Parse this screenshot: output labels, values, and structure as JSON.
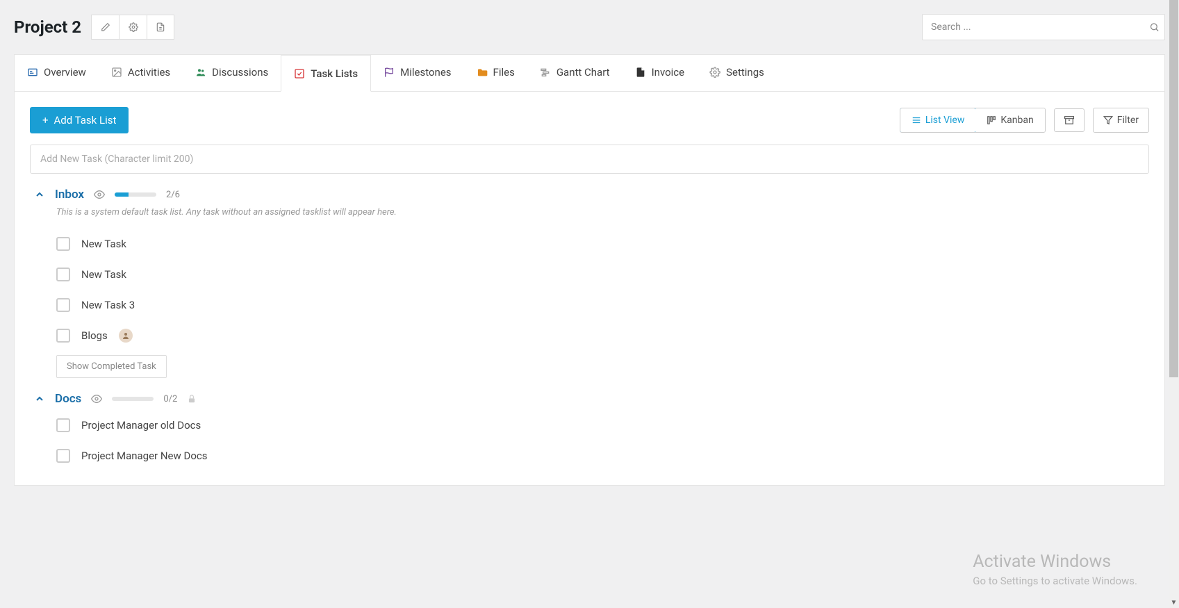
{
  "header": {
    "title": "Project 2",
    "search_placeholder": "Search ..."
  },
  "tabs": [
    {
      "id": "overview",
      "label": "Overview",
      "icon": "overview",
      "color": "#2b6cb0"
    },
    {
      "id": "activities",
      "label": "Activities",
      "icon": "image",
      "color": "#999"
    },
    {
      "id": "discussions",
      "label": "Discussions",
      "icon": "people",
      "color": "#2e8b57"
    },
    {
      "id": "tasklists",
      "label": "Task Lists",
      "icon": "check",
      "color": "#d63638",
      "active": true
    },
    {
      "id": "milestones",
      "label": "Milestones",
      "icon": "flag",
      "color": "#7a4fa0"
    },
    {
      "id": "files",
      "label": "Files",
      "icon": "folder",
      "color": "#e28c1f"
    },
    {
      "id": "gantt",
      "label": "Gantt Chart",
      "icon": "gantt",
      "color": "#999"
    },
    {
      "id": "invoice",
      "label": "Invoice",
      "icon": "doc",
      "color": "#333"
    },
    {
      "id": "settings",
      "label": "Settings",
      "icon": "gear",
      "color": "#999"
    }
  ],
  "toolbar": {
    "add_tasklist": "Add Task List",
    "list_view": "List View",
    "kanban": "Kanban",
    "filter": "Filter"
  },
  "add_task_placeholder": "Add New Task (Character limit 200)",
  "tasklists": [
    {
      "id": "inbox",
      "title": "Inbox",
      "desc": "This is a system default task list. Any task without an assigned tasklist will appear here.",
      "progress_done": 2,
      "progress_total": 6,
      "locked": false,
      "tasks": [
        {
          "label": "New Task"
        },
        {
          "label": "New Task"
        },
        {
          "label": "New Task 3"
        },
        {
          "label": "Blogs",
          "has_avatar": true
        }
      ],
      "show_completed_label": "Show Completed Task"
    },
    {
      "id": "docs",
      "title": "Docs",
      "desc": "",
      "progress_done": 0,
      "progress_total": 2,
      "locked": true,
      "tasks": [
        {
          "label": "Project Manager old Docs"
        },
        {
          "label": "Project Manager New Docs"
        }
      ]
    }
  ],
  "watermark": {
    "title": "Activate Windows",
    "sub": "Go to Settings to activate Windows."
  }
}
